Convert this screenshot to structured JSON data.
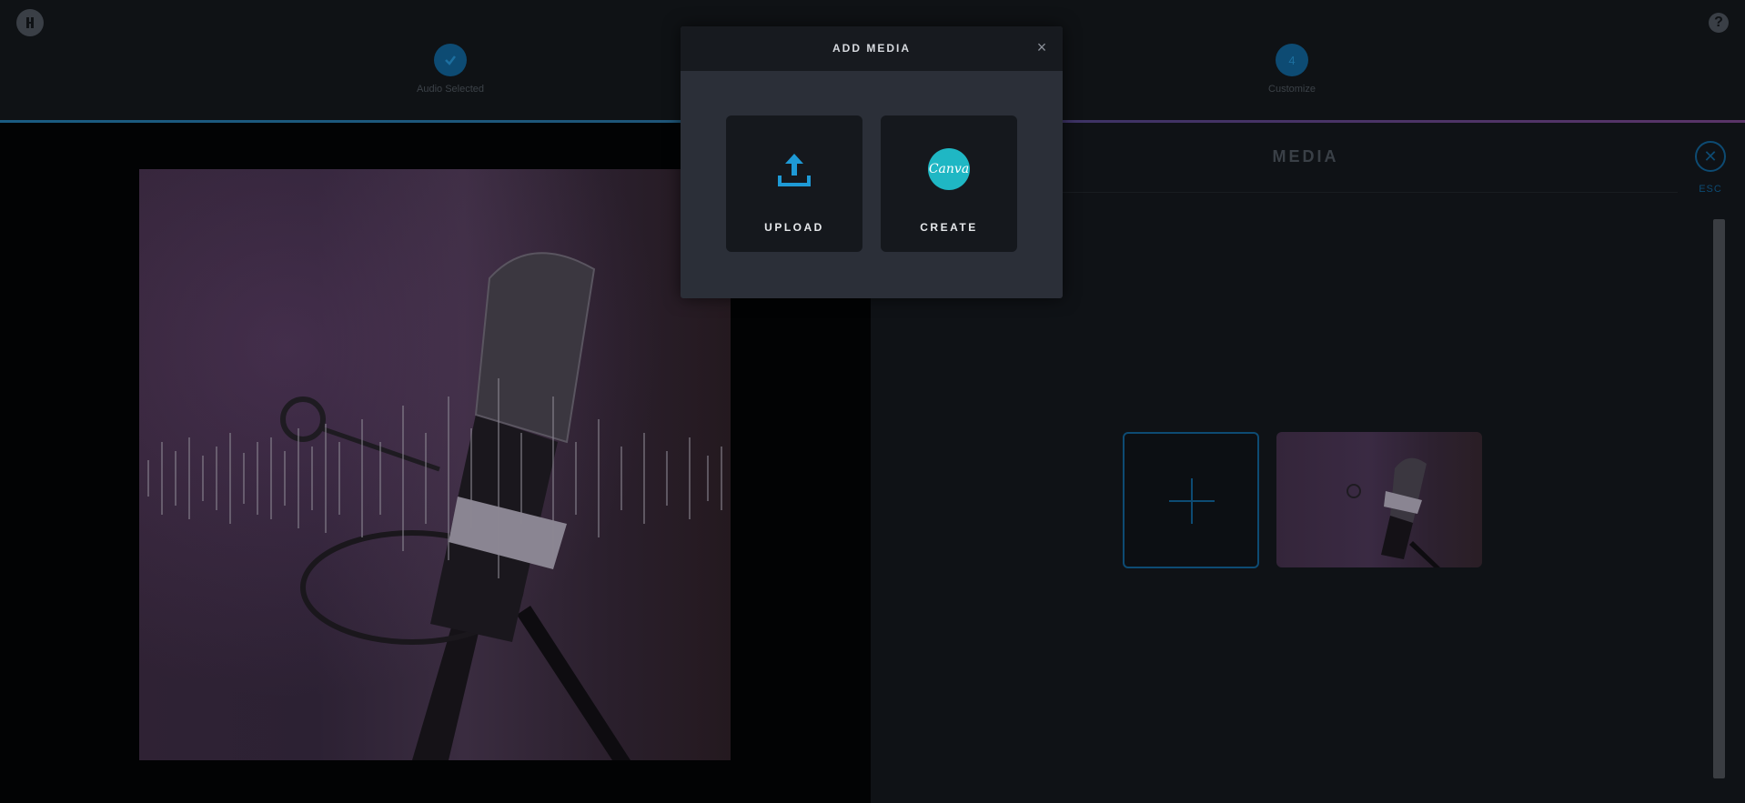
{
  "header": {
    "steps": [
      {
        "label": "Audio Selected",
        "marker": "check-icon"
      },
      {
        "label": "Customize",
        "marker": "4"
      }
    ],
    "help_glyph": "?"
  },
  "media_panel": {
    "title": "MEDIA",
    "esc_label": "ESC"
  },
  "modal": {
    "title": "ADD MEDIA",
    "close_glyph": "×",
    "options": [
      {
        "label": "UPLOAD",
        "icon": "upload-icon"
      },
      {
        "label": "CREATE",
        "icon": "canva-logo",
        "logo_text": "Canva"
      }
    ]
  },
  "colors": {
    "accent": "#1e9ad6",
    "canva": "#1fb7c4",
    "background": "#0b0d10"
  }
}
